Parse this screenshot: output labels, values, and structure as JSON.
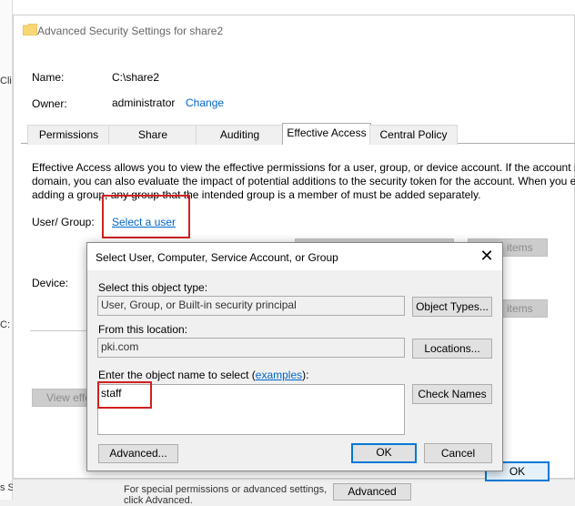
{
  "background": {
    "left_fragments": [
      "Cli",
      "C:",
      "s Selected"
    ],
    "bottom_text1": "For special permissions or advanced settings,",
    "bottom_text2": "click Advanced.",
    "advanced_button": "Advanced",
    "ok_button": "OK"
  },
  "main_window": {
    "title": "Advanced Security Settings for share2",
    "name_label": "Name:",
    "name_value": "C:\\share2",
    "owner_label": "Owner:",
    "owner_value": "administrator",
    "change_link": "Change",
    "tabs": [
      {
        "label": "Permissions",
        "active": false
      },
      {
        "label": "Share",
        "active": false
      },
      {
        "label": "Auditing",
        "active": false
      },
      {
        "label": "Effective Access",
        "active": true
      },
      {
        "label": "Central Policy",
        "active": false
      }
    ],
    "description": [
      "Effective Access allows you to view the effective permissions for a user, group, or device account. If the account is",
      "domain, you can also evaluate the impact of potential additions to the security token for the account. When you e",
      "adding a group, any group that the intended group is a member of must be added separately."
    ],
    "user_group_label": "User/ Group:",
    "select_user_link": "Select a user",
    "device_label": "Device:",
    "items_button": "items",
    "view_effective_button": "View effe"
  },
  "dialog": {
    "title": "Select User, Computer, Service Account, or Group",
    "object_type_label": "Select this object type:",
    "object_type_value": "User, Group, or Built-in security principal",
    "object_types_button": "Object Types...",
    "location_label": "From this location:",
    "location_value": "pki.com",
    "locations_button": "Locations...",
    "enter_label_prefix": "Enter the object name to select (",
    "examples_link": "examples",
    "enter_label_suffix": "):",
    "object_name_value": "staff",
    "check_names_button": "Check Names",
    "advanced_button": "Advanced...",
    "ok_button": "OK",
    "cancel_button": "Cancel"
  }
}
